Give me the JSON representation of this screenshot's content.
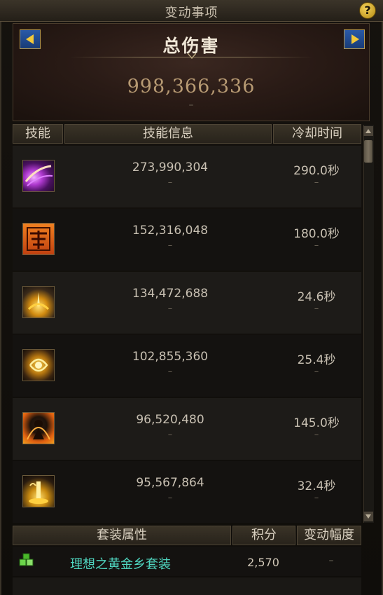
{
  "window": {
    "title": "变动事项",
    "help_label": "?"
  },
  "summary": {
    "title": "总伤害",
    "value": "998,366,336",
    "change": "–"
  },
  "skill_table": {
    "headers": [
      "技能",
      "技能信息",
      "冷却时间"
    ],
    "rows": [
      {
        "damage": "273,990,304",
        "damage_change": "–",
        "cooldown": "290.0秒",
        "cooldown_change": "–",
        "icon": "purple-slash-skill-icon"
      },
      {
        "damage": "152,316,048",
        "damage_change": "–",
        "cooldown": "180.0秒",
        "cooldown_change": "–",
        "icon": "ba-glyph-skill-icon"
      },
      {
        "damage": "134,472,688",
        "damage_change": "–",
        "cooldown": "24.6秒",
        "cooldown_change": "–",
        "icon": "golden-burst-skill-icon"
      },
      {
        "damage": "102,855,360",
        "damage_change": "–",
        "cooldown": "25.4秒",
        "cooldown_change": "–",
        "icon": "golden-swirl-skill-icon"
      },
      {
        "damage": "96,520,480",
        "damage_change": "–",
        "cooldown": "145.0秒",
        "cooldown_change": "–",
        "icon": "flame-figure-skill-icon"
      },
      {
        "damage": "95,567,864",
        "damage_change": "–",
        "cooldown": "32.4秒",
        "cooldown_change": "–",
        "icon": "golden-pillar-skill-icon"
      }
    ]
  },
  "set_table": {
    "headers": [
      "套装属性",
      "积分",
      "变动幅度"
    ],
    "rows": [
      {
        "name": "理想之黄金乡套装",
        "score": "2,570",
        "change": "–",
        "icon": "set-items-icon"
      }
    ]
  },
  "colors": {
    "set_name": "#4fd6c0",
    "value_gold": "#b79a73",
    "arrow_blue": "#2a5aa8"
  }
}
